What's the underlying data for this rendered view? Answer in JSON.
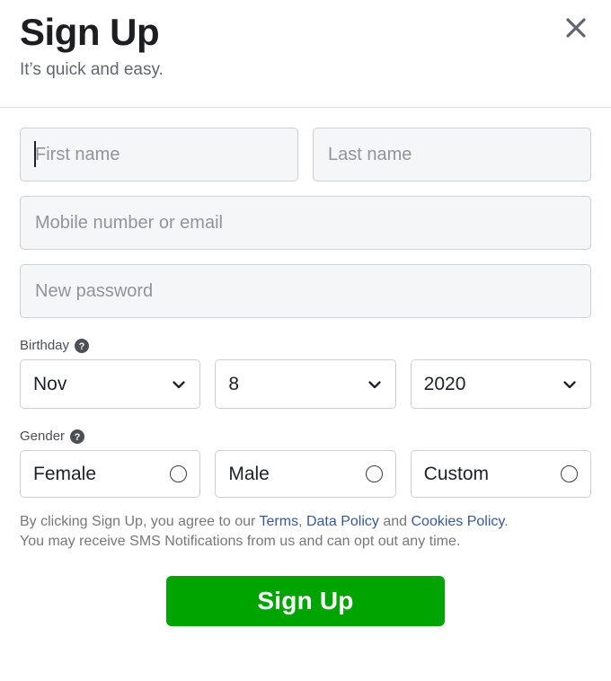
{
  "header": {
    "title": "Sign Up",
    "subtitle": "It’s quick and easy.",
    "close_icon": "close-icon"
  },
  "form": {
    "first_name": {
      "placeholder": "First name",
      "value": "",
      "focused": true
    },
    "last_name": {
      "placeholder": "Last name",
      "value": ""
    },
    "contact": {
      "placeholder": "Mobile number or email",
      "value": ""
    },
    "password": {
      "placeholder": "New password",
      "value": ""
    }
  },
  "birthday": {
    "label": "Birthday",
    "help_icon": "question-mark-circle-icon",
    "month": {
      "value": "Nov",
      "chevron": "chevron-down-icon"
    },
    "day": {
      "value": "8",
      "chevron": "chevron-down-icon"
    },
    "year": {
      "value": "2020",
      "chevron": "chevron-down-icon"
    }
  },
  "gender": {
    "label": "Gender",
    "help_icon": "question-mark-circle-icon",
    "options": [
      {
        "label": "Female",
        "selected": false
      },
      {
        "label": "Male",
        "selected": false
      },
      {
        "label": "Custom",
        "selected": false
      }
    ]
  },
  "legal": {
    "line1_prefix": "By clicking Sign Up, you agree to our ",
    "terms": "Terms",
    "sep1": ", ",
    "data_policy": "Data Policy",
    "sep2": " and ",
    "cookies_policy": "Cookies Policy",
    "line1_suffix": ".",
    "line2": "You may receive SMS Notifications from us and can opt out any time."
  },
  "submit": {
    "label": "Sign Up"
  },
  "colors": {
    "accent_green": "#00a400",
    "link_blue": "#385898",
    "input_bg": "#f5f6f7",
    "border": "#ccd0d5",
    "text_dark": "#1c1e21",
    "text_muted": "#606770",
    "placeholder": "#90949c"
  }
}
